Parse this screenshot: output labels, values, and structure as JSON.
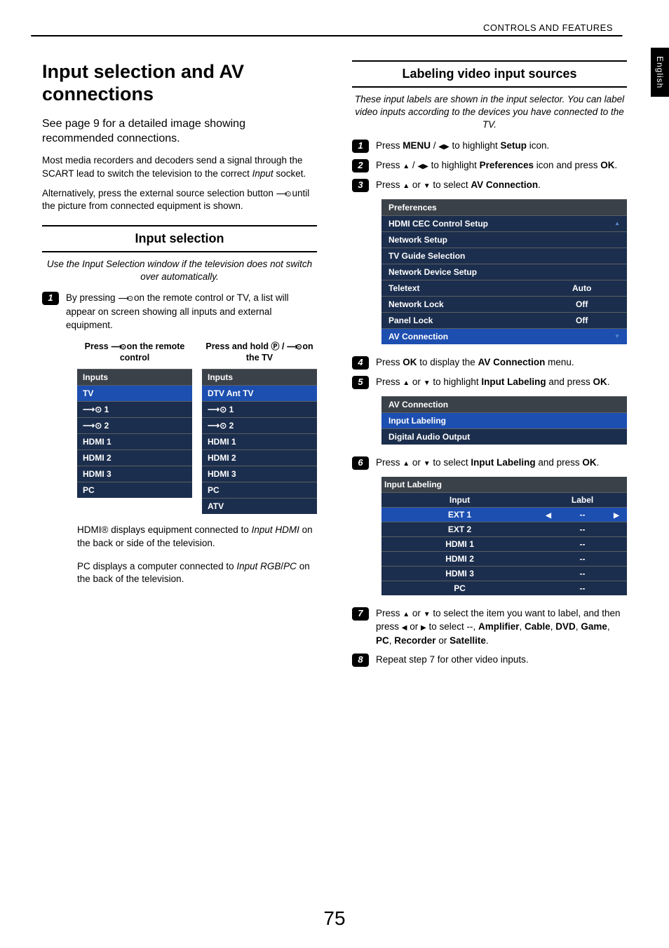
{
  "header": {
    "section": "CONTROLS AND FEATURES",
    "language_tab": "English",
    "page_number": "75"
  },
  "left": {
    "title": "Input selection and AV connections",
    "see_page": "See page 9 for a detailed image showing recommended connections.",
    "para1_a": "Most media recorders and decoders send a signal through the SCART lead to switch the television to the correct ",
    "para1_b_italic": "Input",
    "para1_c": " socket.",
    "para2_a": "Alternatively, press the external source selection button ",
    "para2_b": " until the picture from connected equipment is shown.",
    "section_heading": "Input selection",
    "italic_desc": "Use the Input Selection window if the television does not switch over automatically.",
    "step1_a": "By pressing ",
    "step1_b": " on the remote control or TV, a list will appear on screen showing all inputs and external equipment.",
    "caption_left_a": "Press ",
    "caption_left_b": " on the remote control",
    "caption_right_a": "Press and hold ",
    "caption_right_b": " / ",
    "caption_right_c": " on the TV",
    "inputs_header": "Inputs",
    "inputs_left": [
      "TV",
      "⟶⊙ 1",
      "⟶⊙ 2",
      "HDMI 1",
      "HDMI 2",
      "HDMI 3",
      "PC"
    ],
    "inputs_right": [
      "DTV Ant TV",
      "⟶⊙ 1",
      "⟶⊙ 2",
      "HDMI 1",
      "HDMI 2",
      "HDMI 3",
      "PC",
      "ATV"
    ],
    "note1_a": "HDMI® displays equipment connected to ",
    "note1_b_italic": "Input HDMI",
    "note1_c": " on the back or side of the television.",
    "note2_a": "PC displays a computer connected to ",
    "note2_b_italic": "Input RGB",
    "note2_c": "/",
    "note2_d_italic": "PC",
    "note2_e": " on the back of the television."
  },
  "right": {
    "section_heading": "Labeling video input sources",
    "italic_desc": "These input labels are shown in the input selector. You can label video inputs according to the devices you have connected to the TV.",
    "step1_a": "Press ",
    "step1_menu": "MENU",
    "step1_b": " / ",
    "step1_c": " to highlight ",
    "step1_setup": "Setup",
    "step1_d": " icon.",
    "step2_a": "Press ",
    "step2_b": " / ",
    "step2_c": " to highlight ",
    "step2_pref": "Preferences",
    "step2_d": " icon and press ",
    "step2_ok": "OK",
    "step2_e": ".",
    "step3_a": "Press ",
    "step3_b": " or ",
    "step3_c": " to select ",
    "step3_av": "AV Connection",
    "step3_d": ".",
    "pref_title": "Preferences",
    "pref_rows": [
      {
        "label": "HDMI CEC Control Setup",
        "value": ""
      },
      {
        "label": "Network Setup",
        "value": ""
      },
      {
        "label": "TV Guide Selection",
        "value": ""
      },
      {
        "label": "Network Device Setup",
        "value": ""
      },
      {
        "label": "Teletext",
        "value": "Auto"
      },
      {
        "label": "Network Lock",
        "value": "Off"
      },
      {
        "label": "Panel Lock",
        "value": "Off"
      },
      {
        "label": "AV Connection",
        "value": "",
        "selected": true
      }
    ],
    "step4_a": "Press ",
    "step4_ok": "OK",
    "step4_b": " to display the ",
    "step4_av": "AV Connection",
    "step4_c": " menu.",
    "step5_a": "Press ",
    "step5_b": " or ",
    "step5_c": " to highlight ",
    "step5_il": "Input Labeling",
    "step5_d": " and press ",
    "step5_ok": "OK",
    "step5_e": ".",
    "avc_title": "AV Connection",
    "avc_rows": [
      {
        "label": "Input Labeling",
        "selected": true
      },
      {
        "label": "Digital Audio Output"
      }
    ],
    "step6_a": "Press ",
    "step6_b": " or ",
    "step6_c": " to select ",
    "step6_il": "Input Labeling",
    "step6_d": " and press ",
    "step6_ok": "OK",
    "step6_e": ".",
    "il_title": "Input Labeling",
    "il_col1": "Input",
    "il_col2": "Label",
    "il_rows": [
      {
        "input": "EXT 1",
        "label": "--",
        "selected": true
      },
      {
        "input": "EXT 2",
        "label": "--"
      },
      {
        "input": "HDMI 1",
        "label": "--"
      },
      {
        "input": "HDMI 2",
        "label": "--"
      },
      {
        "input": "HDMI 3",
        "label": "--"
      },
      {
        "input": "PC",
        "label": "--"
      }
    ],
    "step7_a": "Press ",
    "step7_b": " or ",
    "step7_c": " to select the item you want to label, and then press ",
    "step7_d": " or ",
    "step7_e": " to select --, ",
    "step7_amp": "Amplifier",
    "step7_f": ", ",
    "step7_cable": "Cable",
    "step7_g": ", ",
    "step7_dvd": "DVD",
    "step7_h": ", ",
    "step7_game": "Game",
    "step7_i": ", ",
    "step7_pc": "PC",
    "step7_j": ", ",
    "step7_rec": "Recorder",
    "step7_k": " or ",
    "step7_sat": "Satellite",
    "step7_l": ".",
    "step8": "Repeat step 7 for other video inputs."
  }
}
